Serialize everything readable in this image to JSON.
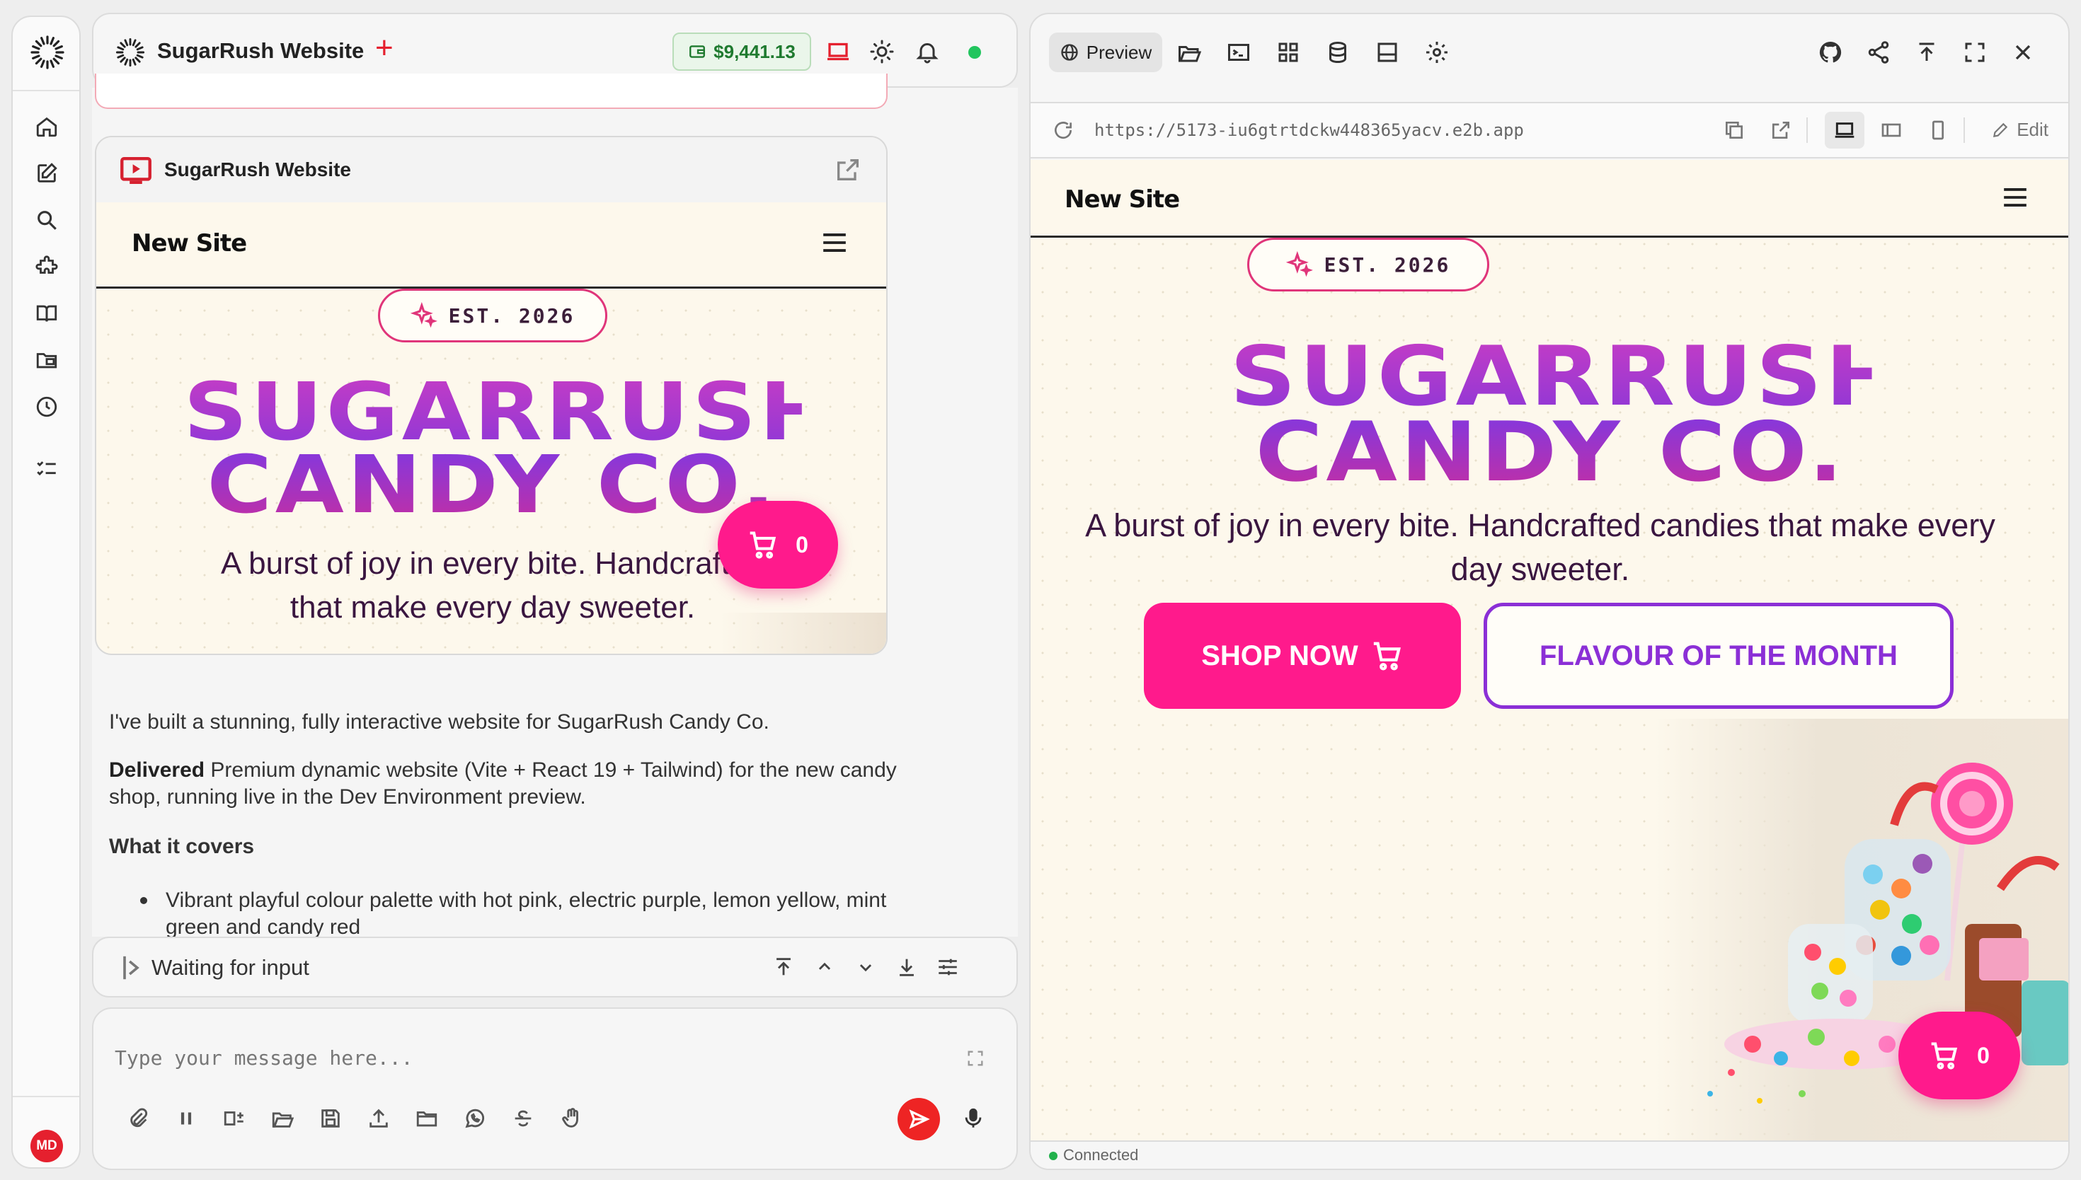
{
  "app": {
    "name": "SugarRush Website",
    "credit": "$9,441.13",
    "user_initials": "MD"
  },
  "rail": {
    "items": [
      "home",
      "new-chat",
      "search",
      "extensions",
      "knowledge",
      "files",
      "history",
      "tasks"
    ]
  },
  "embed": {
    "title": "SugarRush Website"
  },
  "site": {
    "brand": "New Site",
    "badge": "EST. 2026",
    "title_line1": "SUGARRUSH",
    "title_line2": "CANDY CO.",
    "tagline": "A burst of joy in every bite. Handcrafted candies that make every day sweeter.",
    "tagline_small_l1": "A burst of joy in every bite. Handcrafted",
    "tagline_small_l2": "that make every day sweeter.",
    "cart_count": "0",
    "shop_now": "SHOP NOW",
    "flavour": "FLAVOUR OF THE MONTH"
  },
  "chat": {
    "intro": "I've built a stunning, fully interactive website for SugarRush Candy Co.",
    "delivered_label": "Delivered",
    "delivered_text_l1": " Premium dynamic website (Vite + React 19 + Tailwind) for the new candy",
    "delivered_text_l2": "shop, running live in the Dev Environment preview.",
    "covers_heading": "What it covers",
    "bullet1_l1": "Vibrant playful colour palette with hot pink, electric purple, lemon yellow, mint",
    "bullet1_l2": "green and candy red"
  },
  "status": {
    "text": "Waiting for input"
  },
  "input": {
    "placeholder": "Type your message here..."
  },
  "preview": {
    "tab_label": "Preview",
    "url": "https://5173-iu6gtrtdckw448365yacv.e2b.app",
    "edit_label": "Edit",
    "connection": "Connected"
  },
  "colors": {
    "accent_pink": "#ff1a8c",
    "accent_purple": "#8b2fd6",
    "credit_green": "#1f7a2f",
    "brand_red": "#e5202e"
  }
}
